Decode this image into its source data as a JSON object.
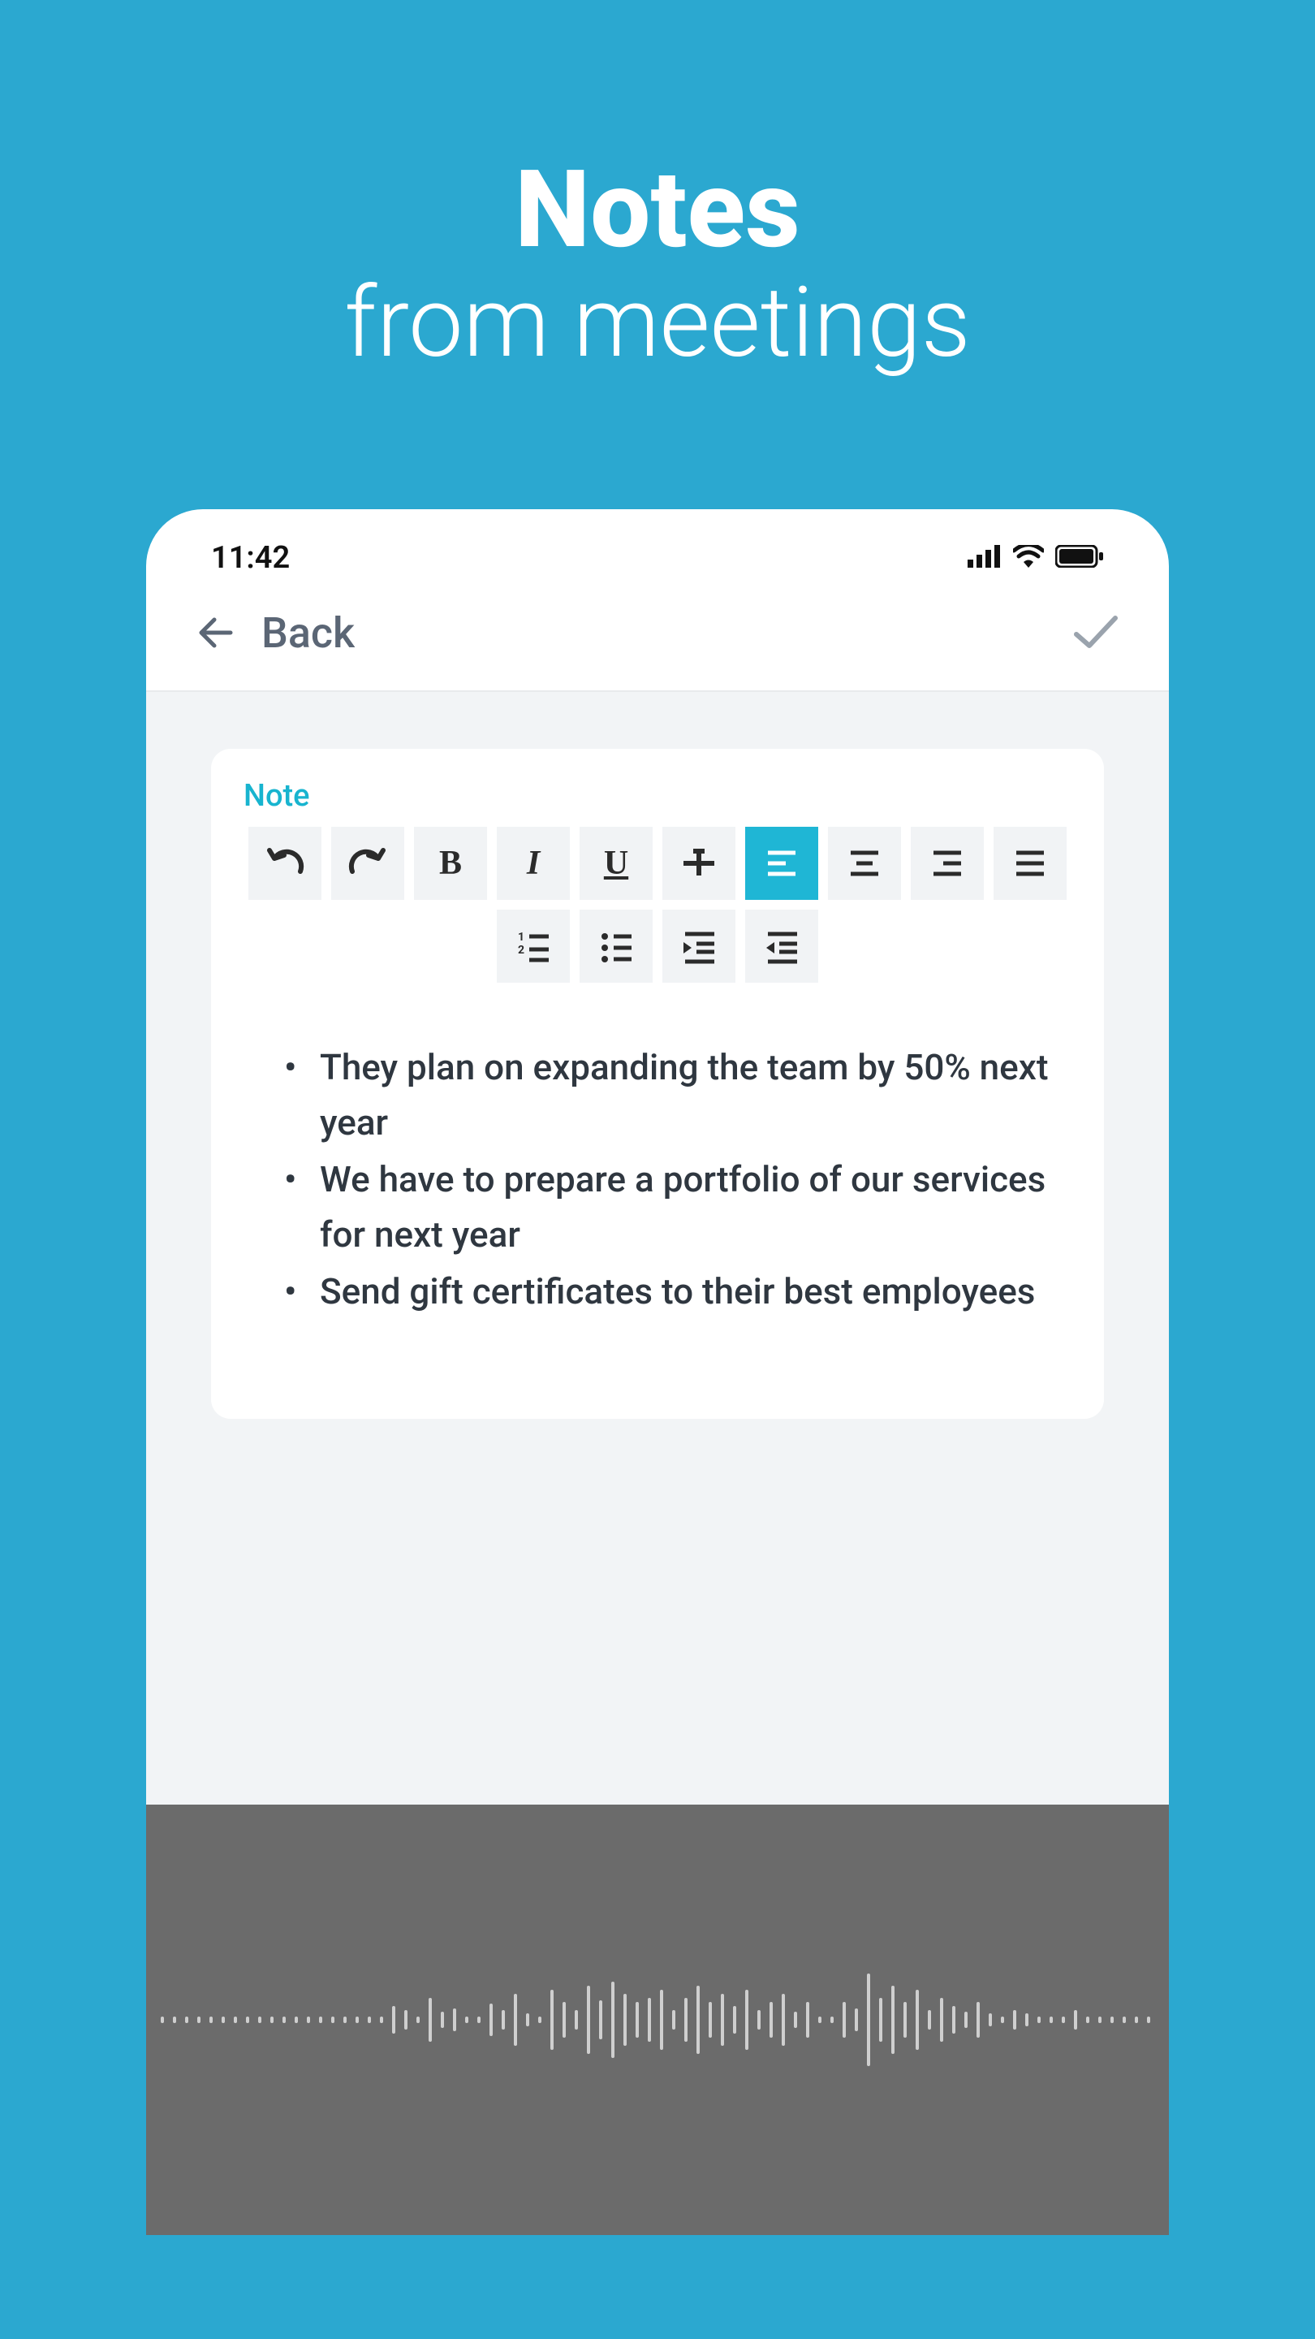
{
  "promo": {
    "title_bold": "Notes",
    "title_light": "from meetings"
  },
  "status_bar": {
    "time": "11:42"
  },
  "nav": {
    "back_label": "Back"
  },
  "note": {
    "label": "Note",
    "bullets": [
      "They plan on expanding the team by 50% next year",
      "We have to prepare a portfolio of our services for next year",
      "Send gift certificates to their best employees"
    ]
  },
  "toolbar": {
    "row1": [
      "undo",
      "redo",
      "bold",
      "italic",
      "underline",
      "strike",
      "align-left",
      "align-center",
      "align-right",
      "align-justify"
    ],
    "row2": [
      "list-ordered",
      "list-bullet",
      "indent",
      "outdent"
    ],
    "active": "align-left"
  }
}
